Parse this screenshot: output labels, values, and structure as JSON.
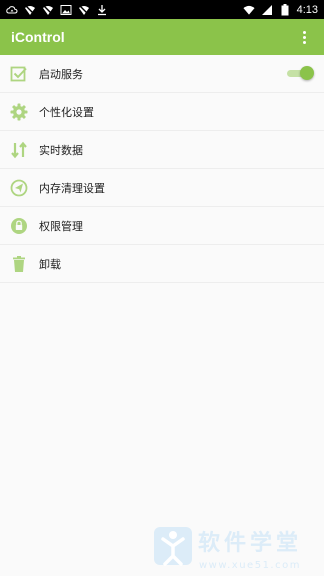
{
  "status_bar": {
    "time": "4:13",
    "notification_icons": [
      "cloud-sync-icon",
      "wifi-off-icon",
      "wifi-off-icon",
      "image-icon",
      "wifi-off-icon",
      "download-icon"
    ],
    "system_icons": [
      "wifi-icon",
      "signal-icon",
      "battery-icon"
    ]
  },
  "app_bar": {
    "title": "iControl",
    "menu_icon": "overflow-menu-icon",
    "background_color": "#8bc34a"
  },
  "menu_items": [
    {
      "label": "启动服务",
      "icon": "checkbox-checked-icon",
      "toggle_on": true
    },
    {
      "label": "个性化设置",
      "icon": "gear-icon"
    },
    {
      "label": "实时数据",
      "icon": "up-down-arrows-icon"
    },
    {
      "label": "内存清理设置",
      "icon": "broom-icon"
    },
    {
      "label": "权限管理",
      "icon": "lock-icon"
    },
    {
      "label": "卸载",
      "icon": "trash-icon"
    }
  ],
  "watermark": {
    "text": "软件学堂",
    "subtext": "www.xue51.com"
  },
  "colors": {
    "accent": "#8bc34a",
    "icon": "#aed581",
    "divider": "#ededed"
  }
}
